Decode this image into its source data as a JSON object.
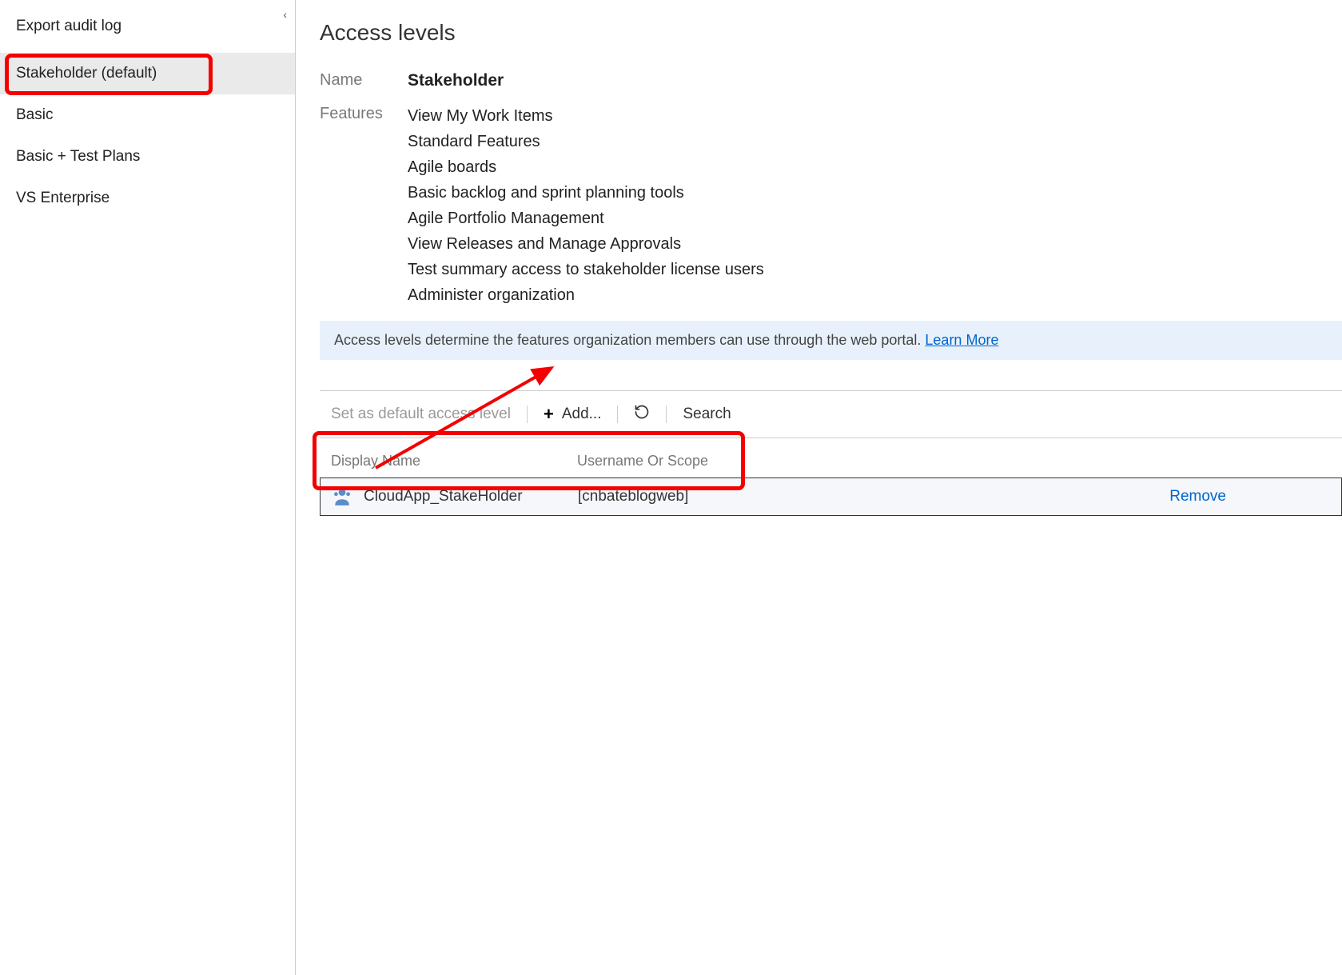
{
  "sidebar": {
    "export_label": "Export audit log",
    "items": [
      {
        "label": "Stakeholder (default)",
        "selected": true
      },
      {
        "label": "Basic",
        "selected": false
      },
      {
        "label": "Basic + Test Plans",
        "selected": false
      },
      {
        "label": "VS Enterprise",
        "selected": false
      }
    ]
  },
  "page": {
    "title": "Access levels",
    "name_label": "Name",
    "name_value": "Stakeholder",
    "features_label": "Features",
    "features": [
      "View My Work Items",
      "Standard Features",
      "Agile boards",
      "Basic backlog and sprint planning tools",
      "Agile Portfolio Management",
      "View Releases and Manage Approvals",
      "Test summary access to stakeholder license users",
      "Administer organization"
    ],
    "info_text": "Access levels determine the features organization members can use through the web portal. ",
    "info_link": "Learn More"
  },
  "toolbar": {
    "set_default": "Set as default access level",
    "add": "Add...",
    "search": "Search"
  },
  "table": {
    "col_displayname": "Display Name",
    "col_username": "Username Or Scope",
    "rows": [
      {
        "display_name": "CloudApp_StakeHolder",
        "username": "[cnbateblogweb]",
        "remove_label": "Remove"
      }
    ]
  }
}
